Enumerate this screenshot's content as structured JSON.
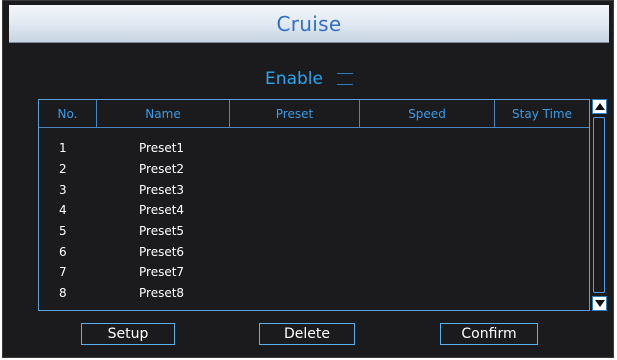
{
  "dialog": {
    "title": "Cruise"
  },
  "enable": {
    "label": "Enable"
  },
  "table": {
    "columns": [
      "No.",
      "Name",
      "Preset",
      "Speed",
      "Stay Time"
    ],
    "rows": [
      {
        "no": "1",
        "name": "Preset1"
      },
      {
        "no": "2",
        "name": "Preset2"
      },
      {
        "no": "3",
        "name": "Preset3"
      },
      {
        "no": "4",
        "name": "Preset4"
      },
      {
        "no": "5",
        "name": "Preset5"
      },
      {
        "no": "6",
        "name": "Preset6"
      },
      {
        "no": "7",
        "name": "Preset7"
      },
      {
        "no": "8",
        "name": "Preset8"
      }
    ]
  },
  "buttons": {
    "setup": "Setup",
    "delete": "Delete",
    "confirm": "Confirm"
  },
  "colors": {
    "accent": "#2aa5f0",
    "title_text": "#2f6fc4",
    "panel_bg": "#1b1b1d",
    "border": "#5aa0e0"
  },
  "icons": {
    "scroll_up": "triangle-up-icon",
    "scroll_down": "triangle-down-icon"
  }
}
